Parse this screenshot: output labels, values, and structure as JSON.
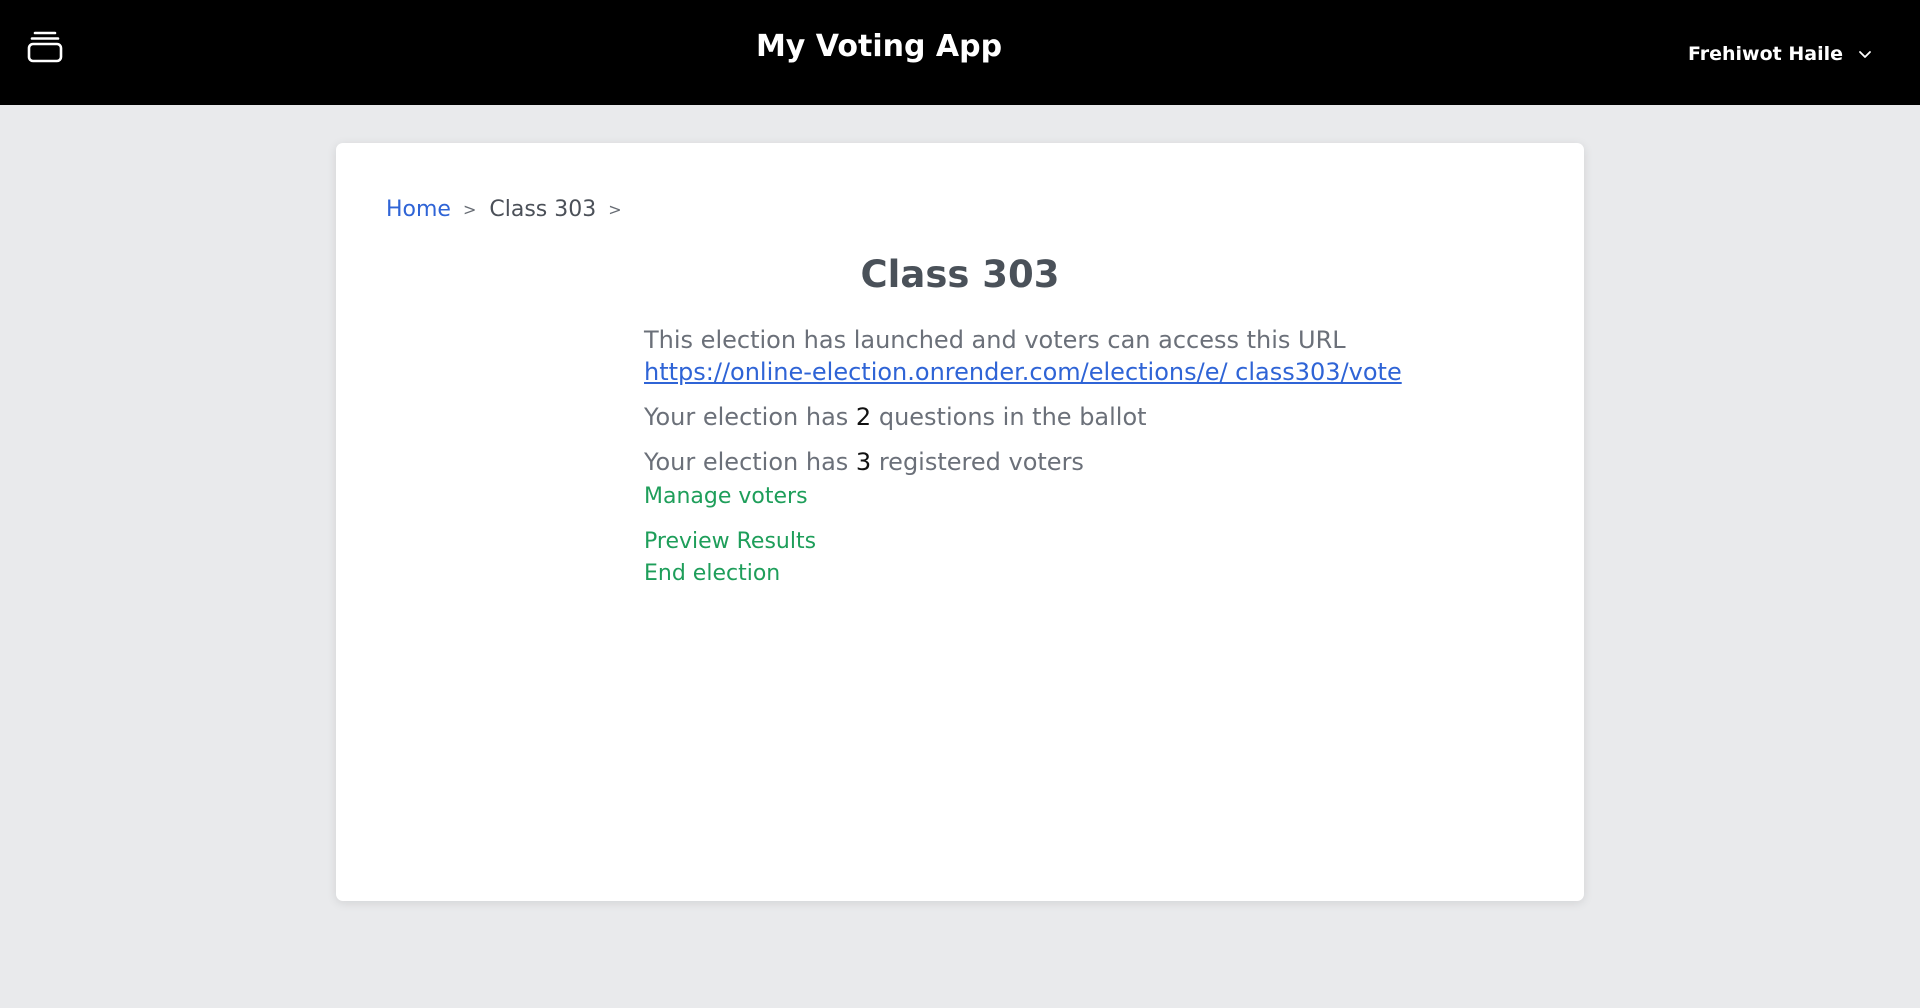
{
  "header": {
    "logo_icon": "stack-icon",
    "app_title": "My Voting App",
    "user_name": "Frehiwot Haile",
    "menu_icon": "chevron-down-icon",
    "background_color": "#000000"
  },
  "breadcrumb": {
    "home_label": "Home",
    "separator": ">",
    "current_label": "Class 303"
  },
  "election": {
    "title": "Class 303",
    "launched_text": "This election has launched and voters can access this URL",
    "vote_url": "https://online-election.onrender.com/elections/e/ class303/vote",
    "questions_prefix": "Your election has",
    "questions_count": "2",
    "questions_suffix": "questions in the ballot",
    "voters_prefix": "Your election has",
    "voters_count": "3",
    "voters_suffix": "registered voters"
  },
  "actions": {
    "manage_voters": "Manage voters",
    "preview_results": "Preview Results",
    "end_election": "End election"
  },
  "colors": {
    "page_background": "#e9eaec",
    "link_blue": "#2f64d6",
    "action_green": "#1e9e5a",
    "text_gray": "#6b7079"
  }
}
